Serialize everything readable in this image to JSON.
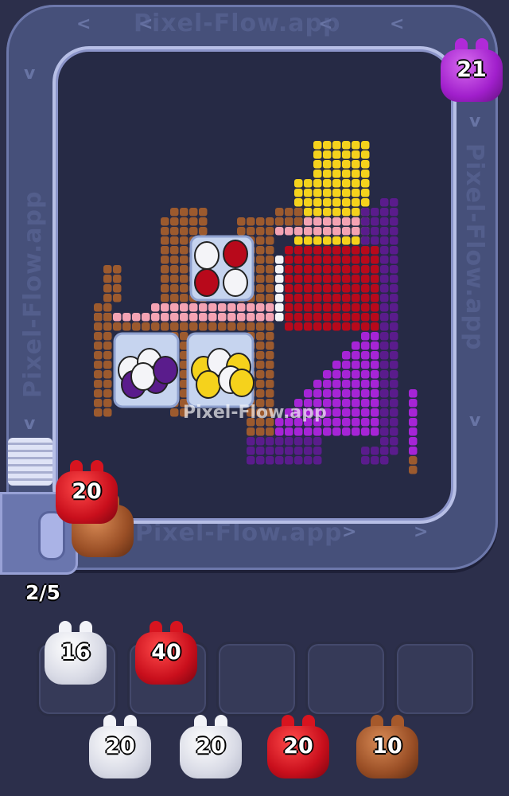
{
  "watermark": {
    "text": "Pixel-Flow.app",
    "center_text": "Pixel-Flow.app"
  },
  "belt": {
    "arrow_glyph_left": "<",
    "arrow_glyph_right": ">",
    "arrow_glyph_down": "v"
  },
  "conveyor_critter": {
    "color": "purple",
    "count": "21"
  },
  "launcher_critters": [
    {
      "color": "red",
      "count": "20"
    },
    {
      "color": "brown",
      "count": ""
    }
  ],
  "launch_counter": "2/5",
  "slots": [
    {
      "occupied": true,
      "color": "white",
      "count": "16"
    },
    {
      "occupied": true,
      "color": "red",
      "count": "40"
    },
    {
      "occupied": false
    },
    {
      "occupied": false
    },
    {
      "occupied": false
    }
  ],
  "queue": [
    {
      "color": "white",
      "count": "20"
    },
    {
      "color": "white",
      "count": "20"
    },
    {
      "color": "red",
      "count": "20"
    },
    {
      "color": "brown",
      "count": "10"
    }
  ],
  "palette": {
    "background": "#2c2f4b",
    "belt": "#46507a",
    "yellow": "#f5d21c",
    "red": "#b8091b",
    "pink": "#f4a3b3",
    "purple": "#a624d6",
    "dark_purple": "#5a1c8c",
    "brown": "#9c5a2e",
    "white": "#f4f4f8"
  }
}
